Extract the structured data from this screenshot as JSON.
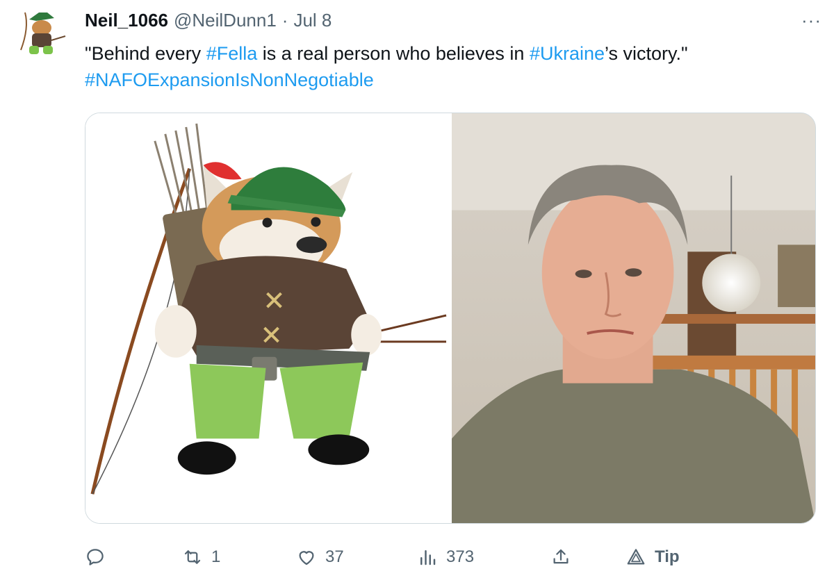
{
  "tweet": {
    "author": {
      "display_name": "Neil_1066",
      "handle": "@NeilDunn1",
      "separator": "·",
      "date": "Jul 8"
    },
    "more_label": "···",
    "text_parts": {
      "t1": "\"Behind every ",
      "h1": "#Fella",
      "t2": " is a real person who believes in ",
      "h2": "#Ukraine",
      "t3": "’s victory.\"",
      "h3": "#NAFOExpansionIsNonNegotiable"
    },
    "media": [
      {
        "kind": "image",
        "subject": "cartoon shiba dog in archer costume"
      },
      {
        "kind": "image",
        "subject": "selfie photo of a man"
      }
    ],
    "actions": {
      "reply_count": "",
      "retweet_count": "1",
      "like_count": "37",
      "views_count": "373",
      "tip_label": "Tip"
    }
  },
  "colors": {
    "link": "#1d9bf0",
    "text": "#0f1419",
    "muted": "#536471",
    "border": "#cfd9de"
  },
  "icons": [
    "avatar-image",
    "more-icon",
    "reply-icon",
    "retweet-icon",
    "like-icon",
    "views-icon",
    "share-icon",
    "tip-icon"
  ]
}
